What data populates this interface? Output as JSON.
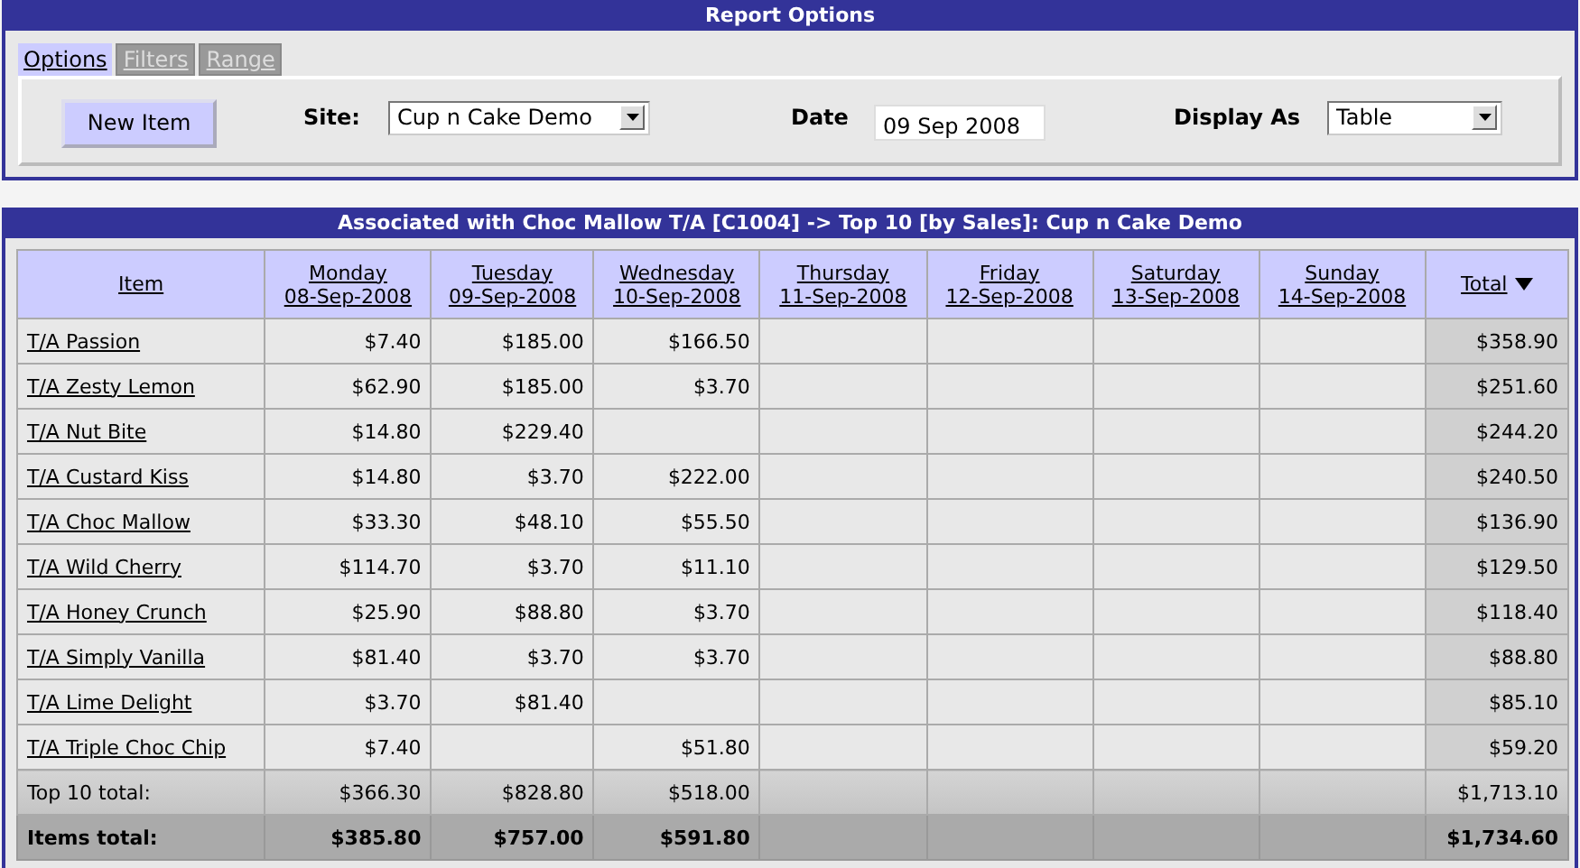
{
  "options_panel": {
    "title": "Report Options",
    "tabs": [
      {
        "label": "Options",
        "selected": true
      },
      {
        "label": "Filters",
        "selected": false
      },
      {
        "label": "Range",
        "selected": false
      }
    ],
    "new_item_button": "New Item",
    "site": {
      "label": "Site:",
      "value": "Cup n Cake Demo"
    },
    "date": {
      "label": "Date",
      "value": "09 Sep 2008"
    },
    "display_as": {
      "label": "Display As",
      "value": "Table"
    }
  },
  "report": {
    "title": "Associated with Choc Mallow T/A [C1004] -> Top 10 [by Sales]: Cup n Cake Demo",
    "columns": [
      {
        "label": "Item"
      },
      {
        "label": "Monday",
        "date": "08-Sep-2008"
      },
      {
        "label": "Tuesday",
        "date": "09-Sep-2008"
      },
      {
        "label": "Wednesday",
        "date": "10-Sep-2008"
      },
      {
        "label": "Thursday",
        "date": "11-Sep-2008"
      },
      {
        "label": "Friday",
        "date": "12-Sep-2008"
      },
      {
        "label": "Saturday",
        "date": "13-Sep-2008"
      },
      {
        "label": "Sunday",
        "date": "14-Sep-2008"
      },
      {
        "label": "Total",
        "sorted_descending": true
      }
    ],
    "rows": [
      {
        "kind": "item",
        "item": "T/A Passion",
        "monday": "$7.40",
        "tuesday": "$185.00",
        "wednesday": "$166.50",
        "total": "$358.90"
      },
      {
        "kind": "item",
        "item": "T/A Zesty Lemon",
        "monday": "$62.90",
        "tuesday": "$185.00",
        "wednesday": "$3.70",
        "total": "$251.60"
      },
      {
        "kind": "item",
        "item": "T/A Nut Bite",
        "monday": "$14.80",
        "tuesday": "$229.40",
        "total": "$244.20"
      },
      {
        "kind": "item",
        "item": "T/A Custard Kiss",
        "monday": "$14.80",
        "tuesday": "$3.70",
        "wednesday": "$222.00",
        "total": "$240.50"
      },
      {
        "kind": "item",
        "item": "T/A Choc Mallow",
        "monday": "$33.30",
        "tuesday": "$48.10",
        "wednesday": "$55.50",
        "total": "$136.90"
      },
      {
        "kind": "item",
        "item": "T/A Wild Cherry",
        "monday": "$114.70",
        "tuesday": "$3.70",
        "wednesday": "$11.10",
        "total": "$129.50"
      },
      {
        "kind": "item",
        "item": "T/A Honey Crunch",
        "monday": "$25.90",
        "tuesday": "$88.80",
        "wednesday": "$3.70",
        "total": "$118.40"
      },
      {
        "kind": "item",
        "item": "T/A Simply Vanilla",
        "monday": "$81.40",
        "tuesday": "$3.70",
        "wednesday": "$3.70",
        "total": "$88.80"
      },
      {
        "kind": "item",
        "item": "T/A Lime Delight",
        "monday": "$3.70",
        "tuesday": "$81.40",
        "total": "$85.10"
      },
      {
        "kind": "item",
        "item": "T/A Triple Choc Chip",
        "monday": "$7.40",
        "wednesday": "$51.80",
        "total": "$59.20"
      },
      {
        "kind": "subtotal",
        "item": "Top 10 total:",
        "monday": "$366.30",
        "tuesday": "$828.80",
        "wednesday": "$518.00",
        "total": "$1,713.10"
      },
      {
        "kind": "grand_total",
        "item": "Items total:",
        "monday": "$385.80",
        "tuesday": "$757.00",
        "wednesday": "$591.80",
        "total": "$1,734.60"
      }
    ]
  }
}
